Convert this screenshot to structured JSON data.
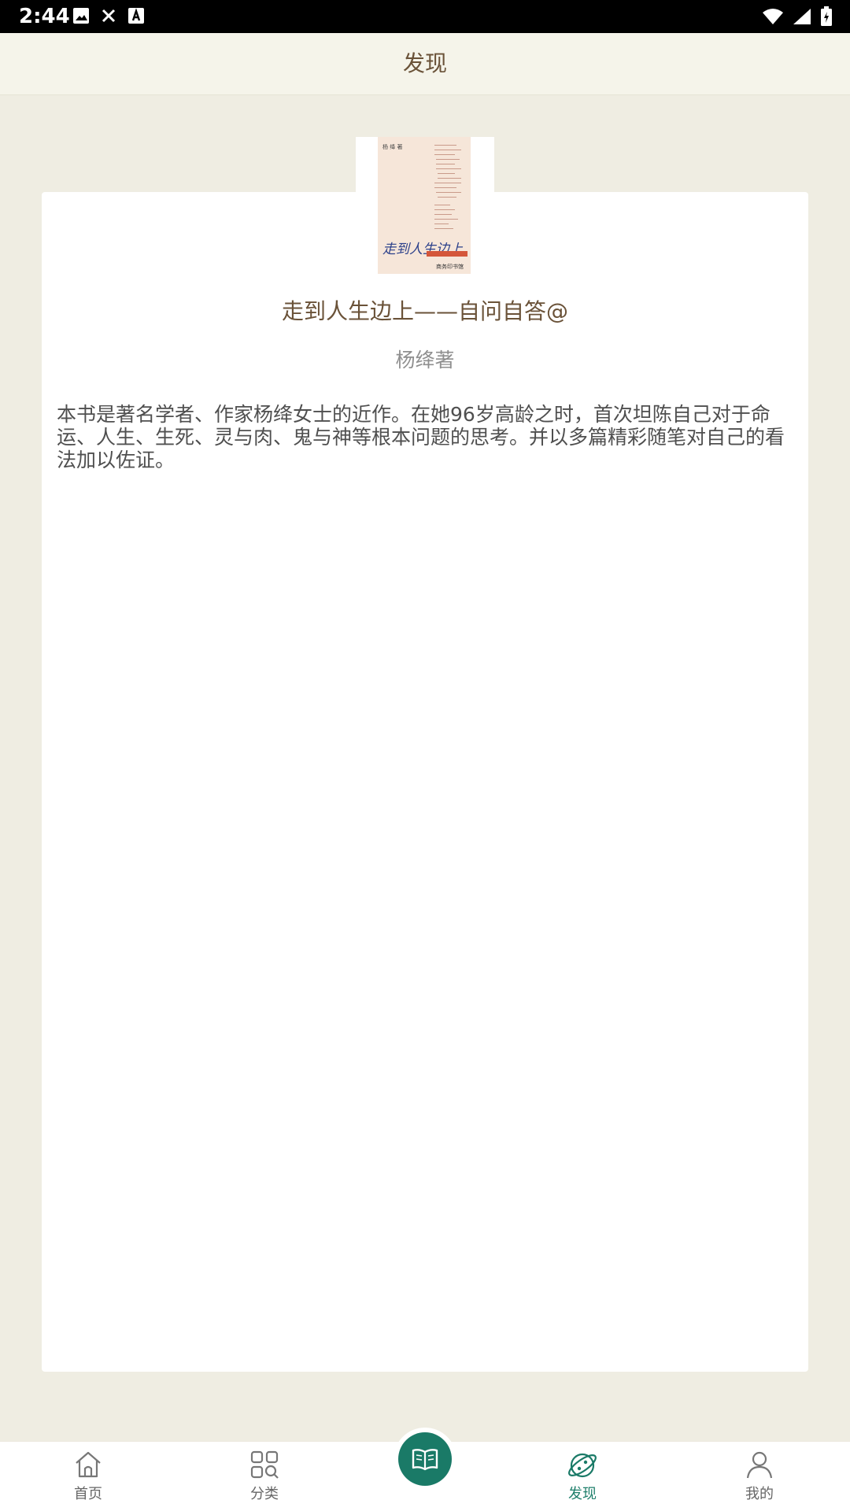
{
  "status_bar": {
    "time": "2:44",
    "left_icons": [
      "image-icon",
      "close-icon",
      "font-icon"
    ],
    "right_icons": [
      "wifi-icon",
      "signal-icon",
      "battery-icon"
    ]
  },
  "header": {
    "title": "发现"
  },
  "book": {
    "title": "走到人生边上——自问自答@",
    "author": "杨绛著",
    "description": "本书是著名学者、作家杨绛女士的近作。在她96岁高龄之时，首次坦陈自己对于命运、人生、生死、灵与肉、鬼与神等根本问题的思考。并以多篇精彩随笔对自己的看法加以佐证。",
    "cover": {
      "author_mini": "杨 绛 著",
      "title_script": "走到人生边上",
      "publisher": "商务印书馆"
    }
  },
  "bottom_nav": {
    "items": [
      {
        "label": "首页",
        "icon": "home-icon"
      },
      {
        "label": "分类",
        "icon": "category-icon"
      },
      {
        "label": "发现",
        "icon": "discover-icon",
        "active": true
      },
      {
        "label": "我的",
        "icon": "profile-icon"
      }
    ],
    "center_icon": "open-book-icon"
  },
  "colors": {
    "accent": "#1a7a67",
    "title_brown": "#6a5238",
    "background": "#efede2"
  }
}
